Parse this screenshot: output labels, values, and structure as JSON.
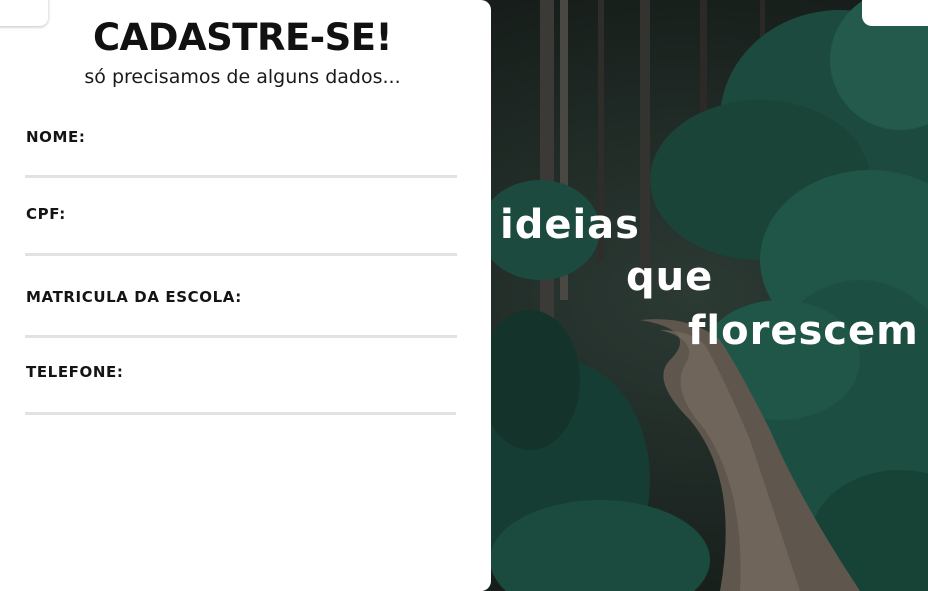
{
  "form": {
    "title": "CADASTRE-SE!",
    "subtitle": "só precisamos de alguns dados...",
    "fields": [
      {
        "label": "NOME:",
        "value": ""
      },
      {
        "label": "CPF:",
        "value": ""
      },
      {
        "label": "MATRICULA DA ESCOLA:",
        "value": ""
      },
      {
        "label": "TELEFONE:",
        "value": ""
      }
    ]
  },
  "hero": {
    "slogan_line1": "ideias",
    "slogan_line2": "que",
    "slogan_line3": "florescem"
  },
  "colors": {
    "panel_bg": "#ffffff",
    "input_underline": "#e2e2e2",
    "forest_dark": "#1c2420",
    "foliage": "#1f5a4a",
    "path": "#6b6055"
  }
}
